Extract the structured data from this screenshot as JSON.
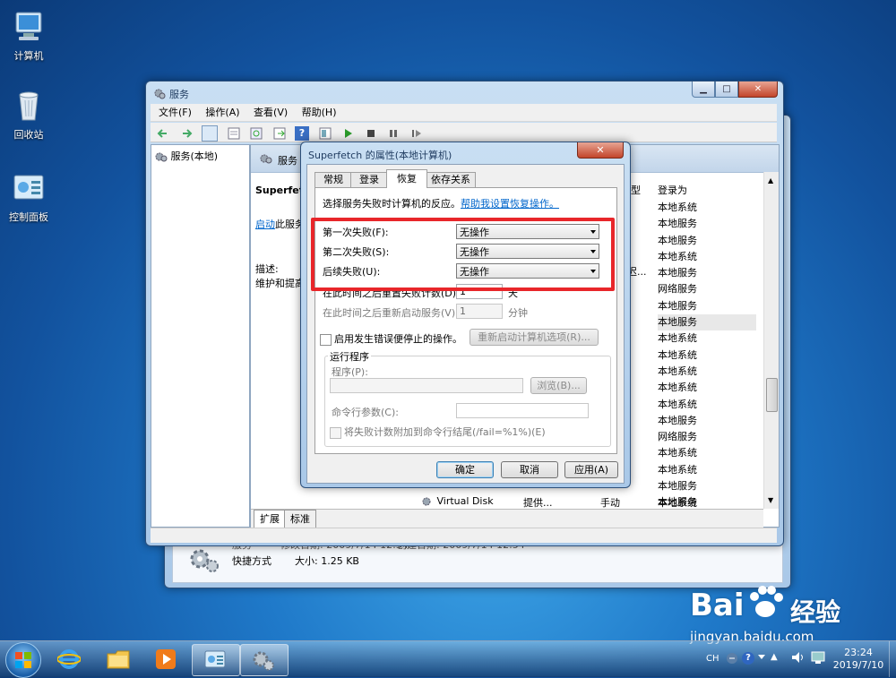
{
  "desktop": {
    "icons": [
      {
        "label": "计算机",
        "icon": "computer-icon"
      },
      {
        "label": "回收站",
        "icon": "recycle-bin-icon"
      },
      {
        "label": "控制面板",
        "icon": "control-panel-icon"
      }
    ]
  },
  "colors": {
    "accent": "#e8262a",
    "link": "#0066cc",
    "title_blue": "#1e3a5f"
  },
  "services_window": {
    "title": "服务",
    "menu": [
      "文件(F)",
      "操作(A)",
      "查看(V)",
      "帮助(H)"
    ],
    "tree_item": "服务(本地)",
    "header_label": "服务",
    "left_detail": {
      "service_name": "Superfetch",
      "start_link": "启动",
      "start_suffix": "此服务",
      "desc_label": "描述:",
      "desc_text": "维护和提高"
    },
    "columns": {
      "type": "型",
      "logon_as": "登录为"
    },
    "logon_values": [
      "本地系统",
      "本地服务",
      "本地服务",
      "本地系统",
      "本地服务",
      "网络服务",
      "本地服务",
      "本地服务",
      "本地系统",
      "本地系统",
      "本地系统",
      "本地系统",
      "本地系统",
      "本地服务",
      "网络服务",
      "本地系统",
      "本地系统",
      "本地服务",
      "本地服务",
      "本地系统",
      "本地系统"
    ],
    "partial_start": "迟...",
    "last_row": {
      "name": "Virtual Disk",
      "desc": "提供...",
      "start": "手动",
      "logon": "本地系统"
    },
    "tabs": [
      "扩展",
      "标准"
    ]
  },
  "back_window": {
    "name_label": "服务",
    "modified": "修改日期: 2009/7/14 12:54",
    "created": "创建日期: 2009/7/14 12:54",
    "type": "快捷方式",
    "size": "大小: 1.25 KB"
  },
  "dialog": {
    "title": "Superfetch 的属性(本地计算机)",
    "tabs": [
      "常规",
      "登录",
      "恢复",
      "依存关系"
    ],
    "active_tab": "恢复",
    "intro": "选择服务失败时计算机的反应。",
    "help_link": "帮助我设置恢复操作。",
    "first_failure": {
      "label": "第一次失败(F):",
      "value": "无操作"
    },
    "second_failure": {
      "label": "第二次失败(S):",
      "value": "无操作"
    },
    "subsequent_failure": {
      "label": "后续失败(U):",
      "value": "无操作"
    },
    "reset_count": {
      "label": "在此时间之后重置失败计数(D):",
      "value": "1",
      "unit": "天"
    },
    "restart_service": {
      "label": "在此时间之后重新启动服务(V):",
      "value": "1",
      "unit": "分钟"
    },
    "stop_actions": "启用发生错误便停止的操作。",
    "restart_options": "重新启动计算机选项(R)...",
    "run_program": {
      "group": "运行程序",
      "program_label": "程序(P):",
      "browse": "浏览(B)...",
      "params_label": "命令行参数(C):",
      "append": "将失败计数附加到命令行结尾(/fail=%1%)(E)"
    },
    "buttons": {
      "ok": "确定",
      "cancel": "取消",
      "apply": "应用(A)"
    }
  },
  "taskbar": {
    "lang": "CH",
    "time": "23:24",
    "date": "2019/7/10"
  },
  "watermark": {
    "brand": "Bai",
    "cn": "经验",
    "url": "jingyan.baidu.com"
  }
}
